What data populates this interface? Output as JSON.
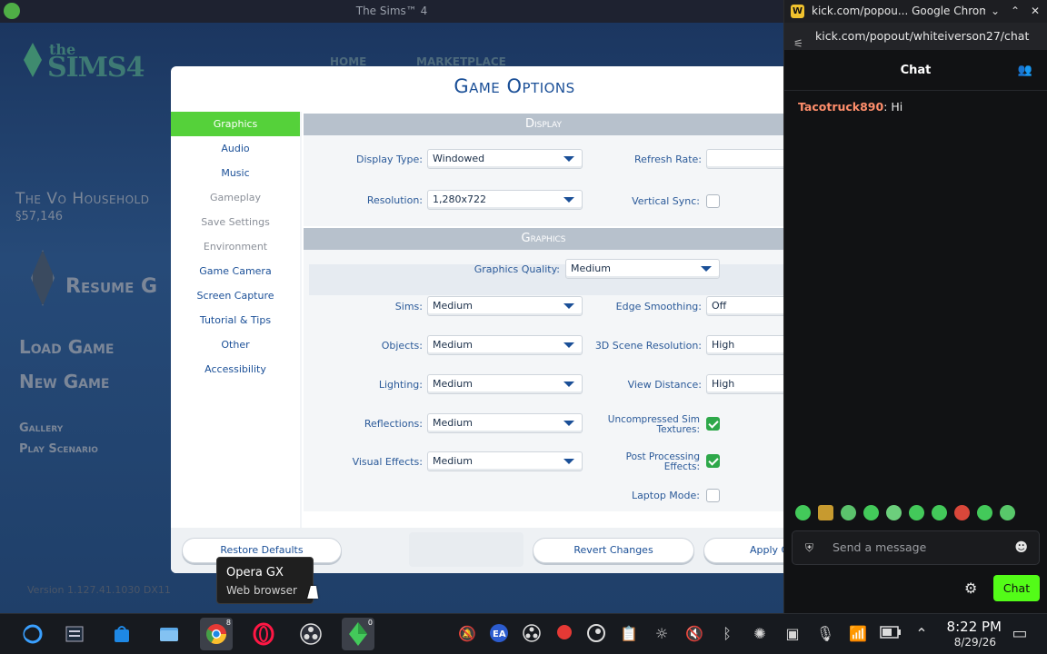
{
  "game_window": {
    "title": "The Sims™ 4",
    "logo": {
      "the": "the",
      "sims": "SIMS4"
    },
    "bg_tabs": [
      "HOME",
      "MARKETPLACE"
    ],
    "household": "The Vo Household",
    "funds": "§57,146",
    "resume": "Resume G",
    "menu_load": "Load Game",
    "menu_new": "New Game",
    "menu_gallery": "Gallery",
    "menu_play_scenario": "Play Scenario",
    "version": "Version 1.127.41.1030 DX11"
  },
  "dialog": {
    "title": "Game Options",
    "categories": [
      {
        "label": "Graphics",
        "state": "active"
      },
      {
        "label": "Audio",
        "state": "normal"
      },
      {
        "label": "Music",
        "state": "normal"
      },
      {
        "label": "Gameplay",
        "state": "disabled"
      },
      {
        "label": "Save Settings",
        "state": "disabled"
      },
      {
        "label": "Environment",
        "state": "disabled"
      },
      {
        "label": "Game Camera",
        "state": "normal"
      },
      {
        "label": "Screen Capture",
        "state": "normal"
      },
      {
        "label": "Tutorial & Tips",
        "state": "normal"
      },
      {
        "label": "Other",
        "state": "normal"
      },
      {
        "label": "Accessibility",
        "state": "normal"
      }
    ],
    "display": {
      "header": "Display",
      "display_type_label": "Display Type:",
      "display_type_value": "Windowed",
      "resolution_label": "Resolution:",
      "resolution_value": "1,280x722",
      "refresh_rate_label": "Refresh Rate:",
      "vsync_label": "Vertical Sync:",
      "vsync_checked": false
    },
    "graphics": {
      "header": "Graphics",
      "quality_label": "Graphics Quality:",
      "quality_value": "Medium",
      "sims_label": "Sims:",
      "sims_value": "Medium",
      "objects_label": "Objects:",
      "objects_value": "Medium",
      "lighting_label": "Lighting:",
      "lighting_value": "Medium",
      "reflections_label": "Reflections:",
      "reflections_value": "Medium",
      "visual_effects_label": "Visual Effects:",
      "visual_effects_value": "Medium",
      "edge_smoothing_label": "Edge Smoothing:",
      "edge_smoothing_value": "Off",
      "scene_res_label": "3D Scene Resolution:",
      "scene_res_value": "High",
      "view_distance_label": "View Distance:",
      "view_distance_value": "High",
      "uncompressed_label_1": "Uncompressed Sim",
      "uncompressed_label_2": "Textures:",
      "uncompressed_checked": true,
      "post_processing_label_1": "Post Processing",
      "post_processing_label_2": "Effects:",
      "post_processing_checked": true,
      "laptop_mode_label": "Laptop Mode:",
      "laptop_mode_checked": false
    },
    "buttons": {
      "restore_defaults": "Restore Defaults",
      "revert_changes": "Revert Changes",
      "apply": "Apply C"
    }
  },
  "tooltip": {
    "title": "Opera GX",
    "subtitle": "Web browser"
  },
  "chrome": {
    "title": "kick.com/popou... Google Chrome",
    "favicon": "W",
    "url": "kick.com/popout/whiteiverson27/chat",
    "chat_header": "Chat",
    "messages": [
      {
        "user": "Tacotruck890",
        "text": ": Hi"
      }
    ],
    "input_placeholder": "Send a message",
    "chat_button": "Chat",
    "accent": "#53fc18"
  },
  "taskbar": {
    "time": "8:22 PM",
    "date": "8/29/26",
    "badge_chrome": "8",
    "badge_sims": "0"
  }
}
